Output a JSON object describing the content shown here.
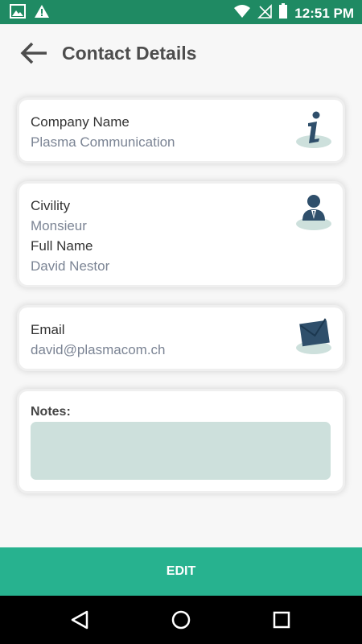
{
  "status_bar": {
    "time": "12:51 PM",
    "icons": [
      "image-icon",
      "warning-icon",
      "wifi-icon",
      "no-signal-icon",
      "battery-icon"
    ]
  },
  "header": {
    "title": "Contact Details",
    "back_icon": "arrow-left-icon"
  },
  "company": {
    "label": "Company Name",
    "value": "Plasma Communication",
    "icon": "info-icon"
  },
  "person": {
    "civility_label": "Civility",
    "civility_value": "Monsieur",
    "fullname_label": "Full Name",
    "fullname_value": "David Nestor",
    "icon": "person-icon"
  },
  "email": {
    "label": "Email",
    "value": "david@plasmacom.ch",
    "icon": "envelope-icon"
  },
  "notes": {
    "label": "Notes:",
    "value": ""
  },
  "edit_button": {
    "label": "EDIT"
  },
  "nav": {
    "icons": [
      "back-triangle-icon",
      "home-circle-icon",
      "recents-square-icon"
    ]
  },
  "colors": {
    "status_bar": "#1f8a63",
    "accent": "#27b28f",
    "notes_bg": "#cde0dc",
    "icon_dark": "#2f4f6b"
  }
}
